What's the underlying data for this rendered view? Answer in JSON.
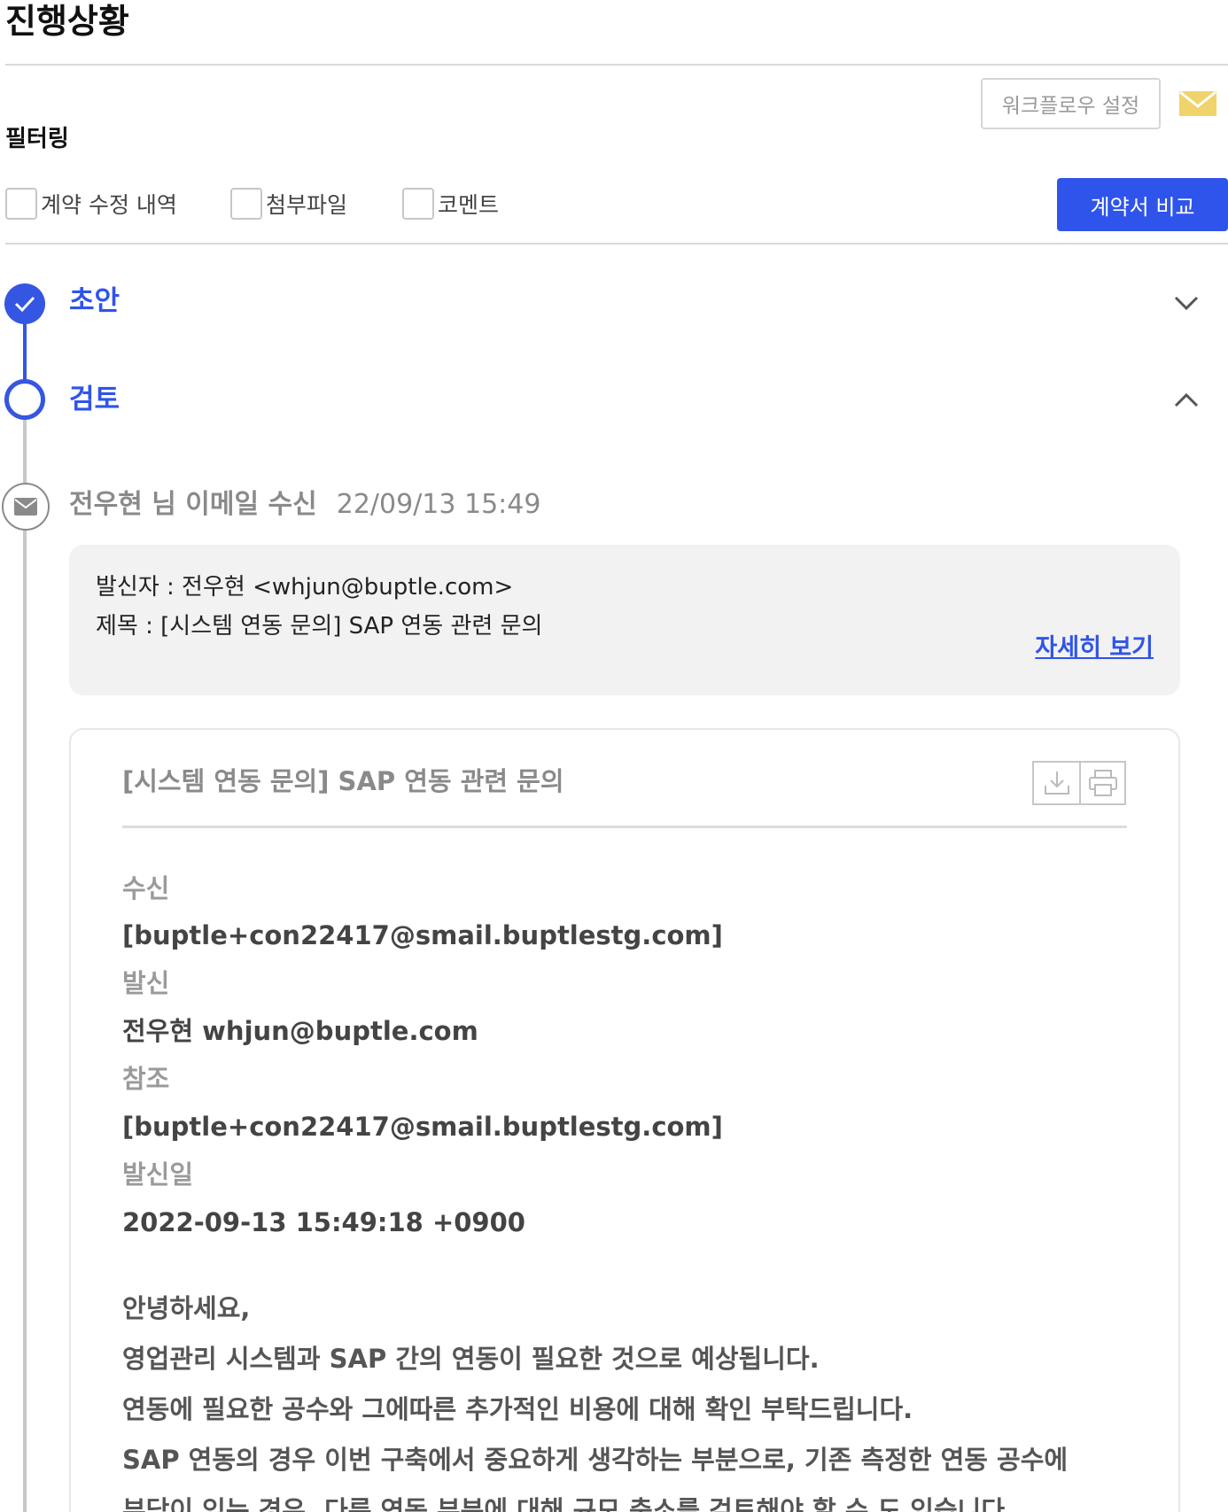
{
  "header": {
    "title": "진행상황"
  },
  "toolbar": {
    "workflow_label": "워크플로우 설정",
    "mail_icon": "mail-icon"
  },
  "filter": {
    "title": "필터링",
    "options": [
      {
        "label": "계약 수정 내역",
        "checked": false
      },
      {
        "label": "첨부파일",
        "checked": false
      },
      {
        "label": "코멘트",
        "checked": false
      }
    ],
    "compare_label": "계약서 비교"
  },
  "steps": [
    {
      "label": "초안",
      "status": "done",
      "expanded": false
    },
    {
      "label": "검토",
      "status": "current",
      "expanded": true
    }
  ],
  "event": {
    "title": "전우현 님 이메일 수신",
    "time": "22/09/13 15:49",
    "summary": {
      "sender": "발신자 : 전우현 <whjun@buptle.com>",
      "subject": "제목 : [시스템 연동 문의] SAP 연동 관련 문의",
      "detail_link": "자세히 보기"
    }
  },
  "mail": {
    "subject": "[시스템 연동 문의] SAP 연동 관련 문의",
    "fields": [
      {
        "label": "수신",
        "value": "[buptle+con22417@smail.buptlestg.com]"
      },
      {
        "label": "발신",
        "value": "전우현 whjun@buptle.com"
      },
      {
        "label": "참조",
        "value": "[buptle+con22417@smail.buptlestg.com]"
      },
      {
        "label": "발신일",
        "value": "2022-09-13 15:49:18 +0900"
      }
    ],
    "body": [
      "안녕하세요,",
      "영업관리 시스템과 SAP 간의 연동이 필요한 것으로 예상됩니다.",
      "연동에 필요한 공수와 그에따른 추가적인 비용에 대해 확인 부탁드립니다.",
      "SAP 연동의 경우 이번 구축에서 중요하게 생각하는 부분으로, 기존 측정한 연동 공수에",
      "부담이 있는 경우, 다른 연동 부분에 대해 규모 축소를 검토해야 할 수 도 있습니다."
    ]
  },
  "colors": {
    "accent": "#2f54eb",
    "mail_icon": "#f0d36b",
    "line_gray": "#c7c7c7"
  }
}
